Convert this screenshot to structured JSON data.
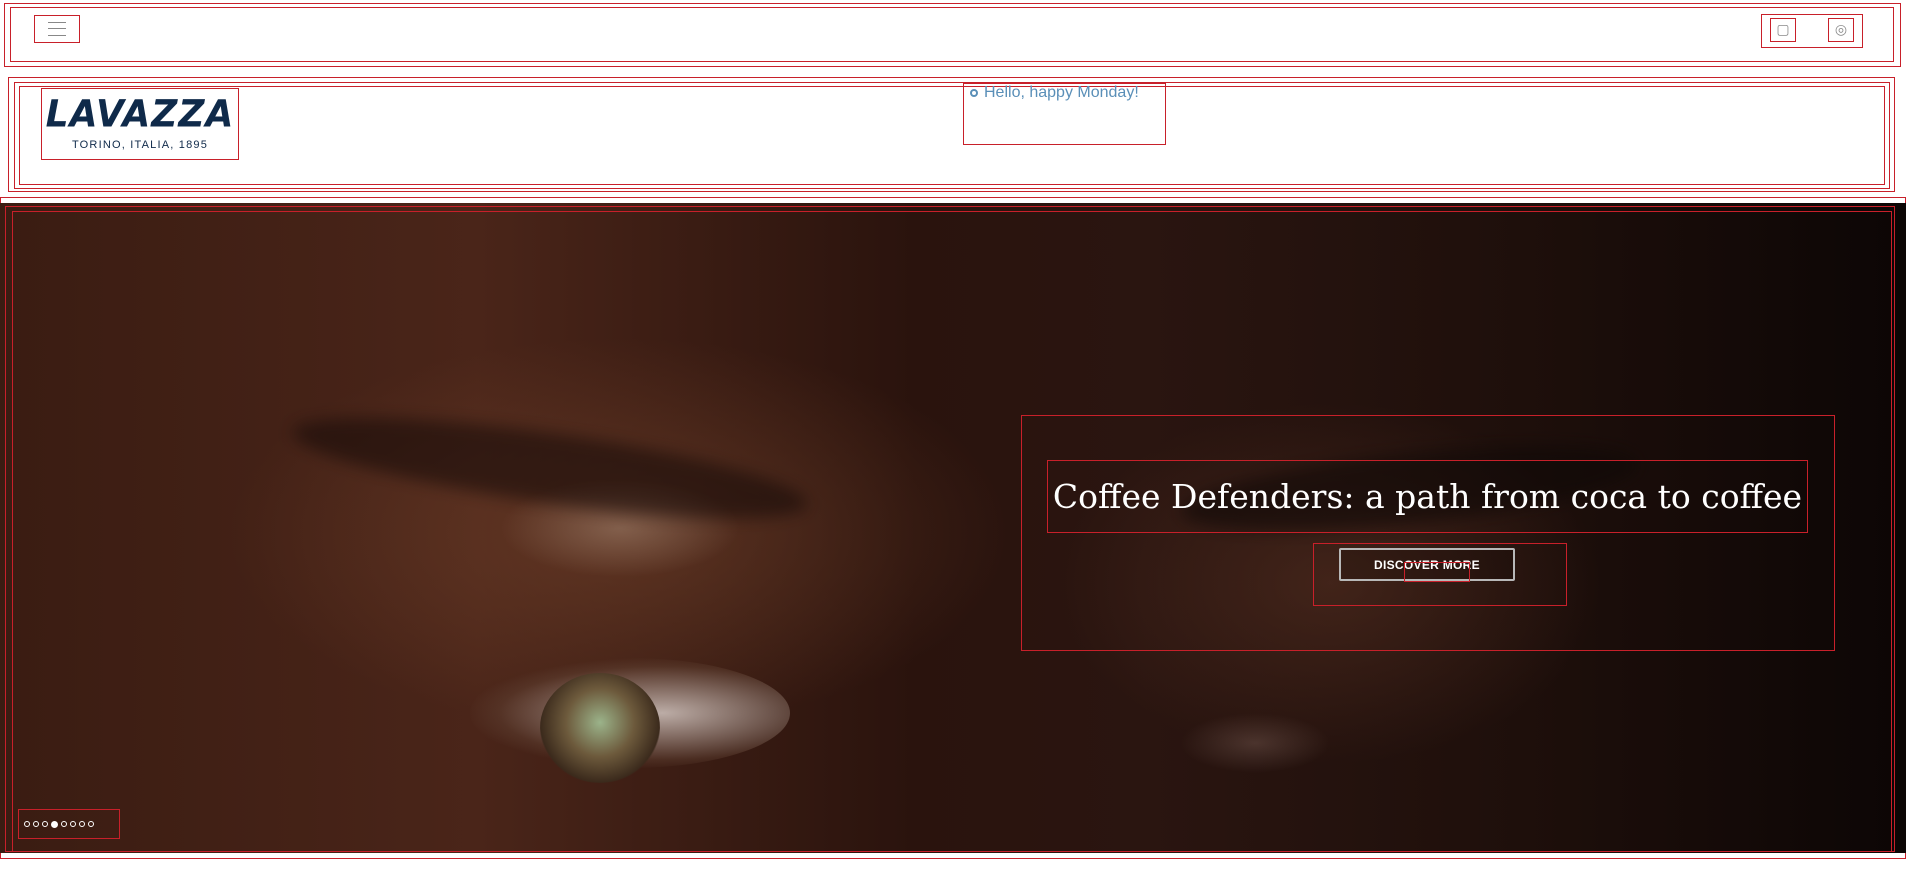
{
  "topbar": {
    "menu_icon": "hamburger-menu-icon",
    "tools": [
      {
        "name": "store-locator-icon",
        "glyph": "▢"
      },
      {
        "name": "coffee-cup-icon",
        "glyph": "◎"
      }
    ]
  },
  "header": {
    "logo": {
      "wordmark": "LAVAZZA",
      "tagline": "TORINO, ITALIA, 1895",
      "color": "#0f2a4a"
    },
    "greeting": "Hello, happy Monday!",
    "greeting_color": "#5a8fb8"
  },
  "hero": {
    "title": "Coffee Defenders: a path from coca to coffee",
    "cta_label": "DISCOVER MORE",
    "slides": [
      {
        "active": false
      },
      {
        "active": false
      },
      {
        "active": false
      },
      {
        "active": true
      },
      {
        "active": false
      },
      {
        "active": false
      },
      {
        "active": false
      },
      {
        "active": false
      }
    ]
  },
  "colors": {
    "outline": "#c8202a"
  }
}
